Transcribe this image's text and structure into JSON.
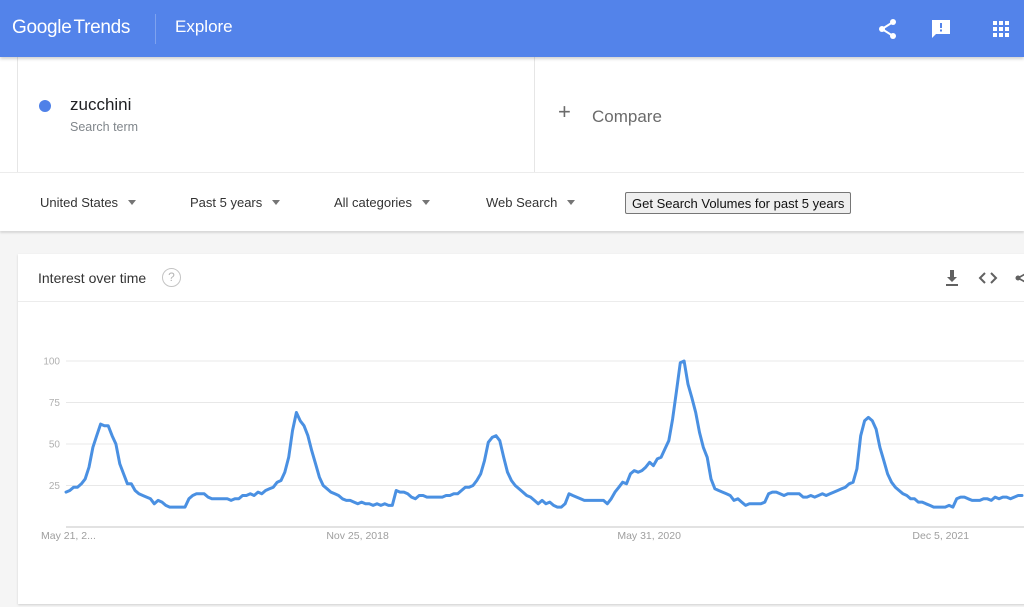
{
  "header": {
    "logo_google": "Google",
    "logo_trends": "Trends",
    "section": "Explore",
    "icons": [
      "share-icon",
      "feedback-icon",
      "apps-grid-icon"
    ],
    "brand_color": "#5383ea"
  },
  "search": {
    "term": "zucchini",
    "term_type": "Search term",
    "term_color": "#4f81e8",
    "compare_label": "Compare"
  },
  "filters": {
    "region": "United States",
    "time_range": "Past 5 years",
    "category": "All categories",
    "search_type": "Web Search",
    "volume_button": "Get Search Volumes for past 5 years"
  },
  "card": {
    "title": "Interest over time",
    "help": "?",
    "icons": [
      "download-icon",
      "embed-icon",
      "share-icon"
    ]
  },
  "chart_data": {
    "type": "line",
    "title": "Interest over time",
    "xlabel": "",
    "ylabel": "",
    "ylim": [
      0,
      100
    ],
    "yticks": [
      25,
      50,
      75,
      100
    ],
    "xtick_labels": [
      "May 21, 2...",
      "Nov 25, 2018",
      "May 31, 2020",
      "Dec 5, 2021"
    ],
    "xtick_positions_fraction": [
      0.0,
      0.305,
      0.61,
      0.915
    ],
    "grid": true,
    "legend": "none",
    "series": [
      {
        "name": "zucchini",
        "color": "#4a90e2",
        "values": [
          21,
          22,
          24,
          24,
          26,
          29,
          36,
          48,
          55,
          62,
          61,
          61,
          55,
          50,
          38,
          32,
          26,
          26,
          22,
          20,
          19,
          18,
          17,
          14,
          16,
          15,
          13,
          12,
          12,
          12,
          12,
          12,
          17,
          19,
          20,
          20,
          20,
          18,
          17,
          17,
          17,
          17,
          17,
          16,
          17,
          17,
          19,
          19,
          20,
          19,
          21,
          20,
          22,
          23,
          24,
          27,
          28,
          33,
          42,
          58,
          69,
          64,
          61,
          55,
          46,
          38,
          30,
          25,
          23,
          21,
          20,
          19,
          17,
          16,
          16,
          15,
          14,
          15,
          14,
          14,
          13,
          14,
          13,
          14,
          13,
          13,
          22,
          21,
          21,
          20,
          18,
          17,
          19,
          19,
          18,
          18,
          18,
          18,
          18,
          19,
          19,
          20,
          20,
          22,
          24,
          24,
          25,
          28,
          32,
          40,
          51,
          54,
          55,
          52,
          42,
          33,
          28,
          25,
          23,
          21,
          19,
          18,
          16,
          14,
          16,
          14,
          15,
          13,
          12,
          12,
          14,
          20,
          19,
          18,
          17,
          16,
          16,
          16,
          16,
          16,
          16,
          14,
          17,
          21,
          24,
          27,
          26,
          32,
          34,
          33,
          34,
          36,
          39,
          37,
          41,
          42,
          47,
          52,
          65,
          82,
          99,
          100,
          86,
          78,
          69,
          57,
          48,
          42,
          29,
          23,
          22,
          21,
          20,
          19,
          16,
          17,
          15,
          13,
          14,
          14,
          14,
          14,
          15,
          20,
          21,
          21,
          20,
          19,
          20,
          20,
          20,
          20,
          18,
          18,
          19,
          18,
          19,
          20,
          19,
          20,
          21,
          22,
          23,
          24,
          26,
          27,
          35,
          55,
          64,
          66,
          64,
          59,
          48,
          40,
          32,
          27,
          24,
          22,
          20,
          19,
          17,
          17,
          15,
          15,
          14,
          13,
          12,
          12,
          12,
          12,
          13,
          12,
          17,
          18,
          18,
          17,
          16,
          16,
          16,
          17,
          17,
          16,
          18,
          17,
          18,
          18,
          17,
          18,
          19,
          19
        ]
      }
    ]
  }
}
